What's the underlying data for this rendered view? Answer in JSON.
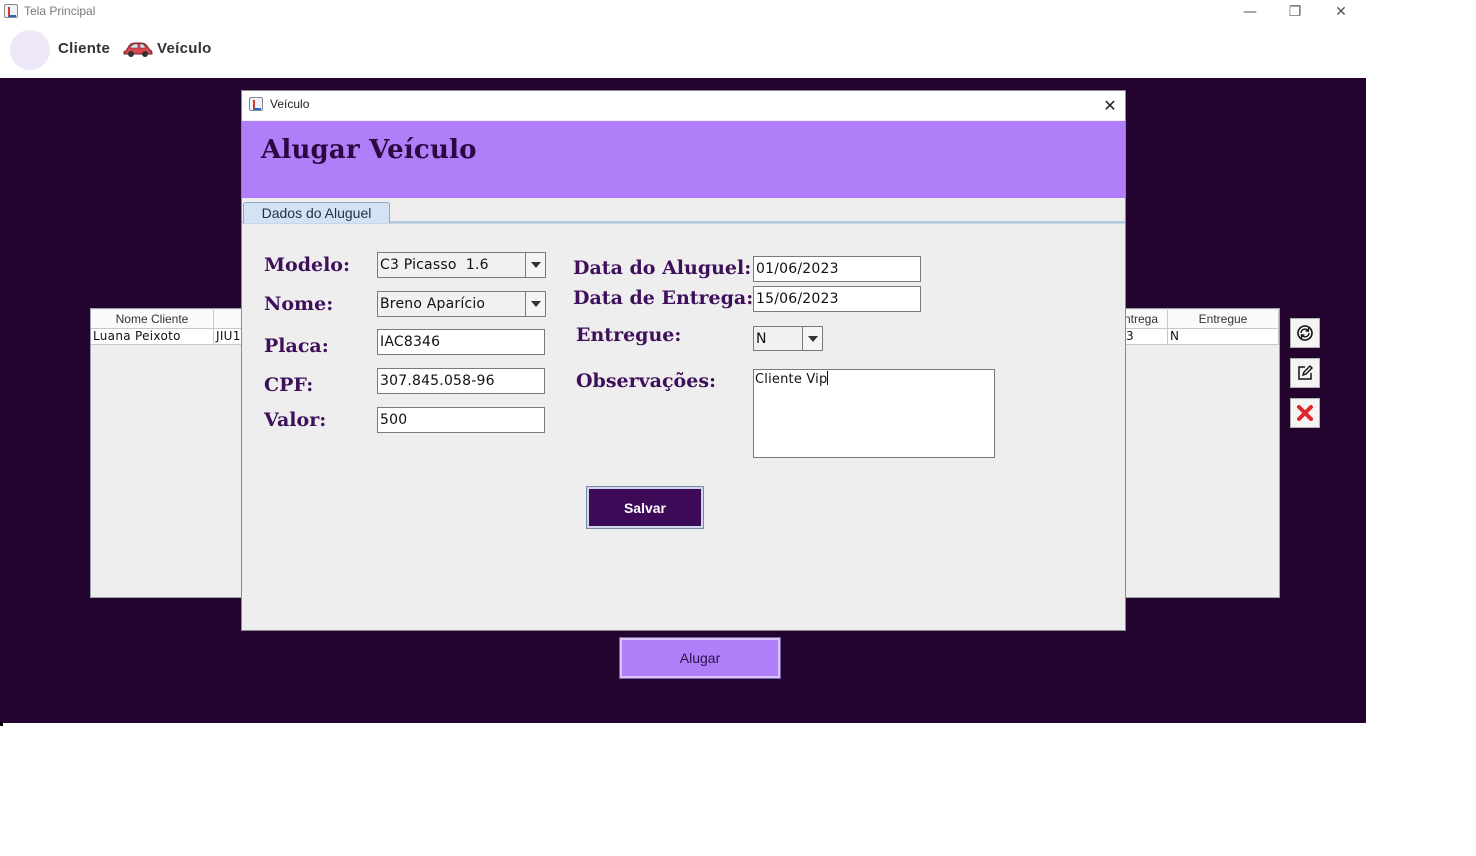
{
  "window": {
    "title": "Tela Principal",
    "minimize_glyph": "—",
    "restore_glyph": "❐",
    "close_glyph": "✕"
  },
  "menu": {
    "items": [
      {
        "label": "Cliente",
        "icon": "user-avatar-icon"
      },
      {
        "label": "Veículo",
        "icon": "car-icon"
      }
    ]
  },
  "background_table": {
    "headers": [
      "Nome Cliente",
      "",
      "ntrega",
      "Entregue"
    ],
    "rows": [
      [
        "Luana Peixoto",
        "JIU1",
        "3",
        "N"
      ]
    ]
  },
  "side_buttons": [
    {
      "icon": "refresh-icon"
    },
    {
      "icon": "edit-icon"
    },
    {
      "icon": "delete-icon"
    }
  ],
  "alugar_button": {
    "label": "Alugar"
  },
  "dialog": {
    "title": "Veículo",
    "close_glyph": "✕",
    "heading": "Alugar Veículo",
    "tab": "Dados do Aluguel",
    "labels": {
      "modelo": "Modelo:",
      "nome": "Nome:",
      "placa": "Placa:",
      "cpf": "CPF:",
      "valor": "Valor:",
      "data_aluguel": "Data do Aluguel:",
      "data_entrega": "Data de Entrega:",
      "entregue": "Entregue:",
      "observacoes": "Observações:"
    },
    "values": {
      "modelo": "C3 Picasso  1.6",
      "nome": "Breno Aparício",
      "placa": "IAC8346",
      "cpf": "307.845.058-96",
      "valor": "500",
      "data_aluguel": "01/06/2023",
      "data_entrega": "15/06/2023",
      "entregue": "N",
      "observacoes": "Cliente Vip"
    },
    "save_label": "Salvar"
  },
  "colors": {
    "desktop": "#23042f",
    "accent": "#b07ef9",
    "label_text": "#3e0f5b",
    "save_button": "#3d0a57"
  }
}
